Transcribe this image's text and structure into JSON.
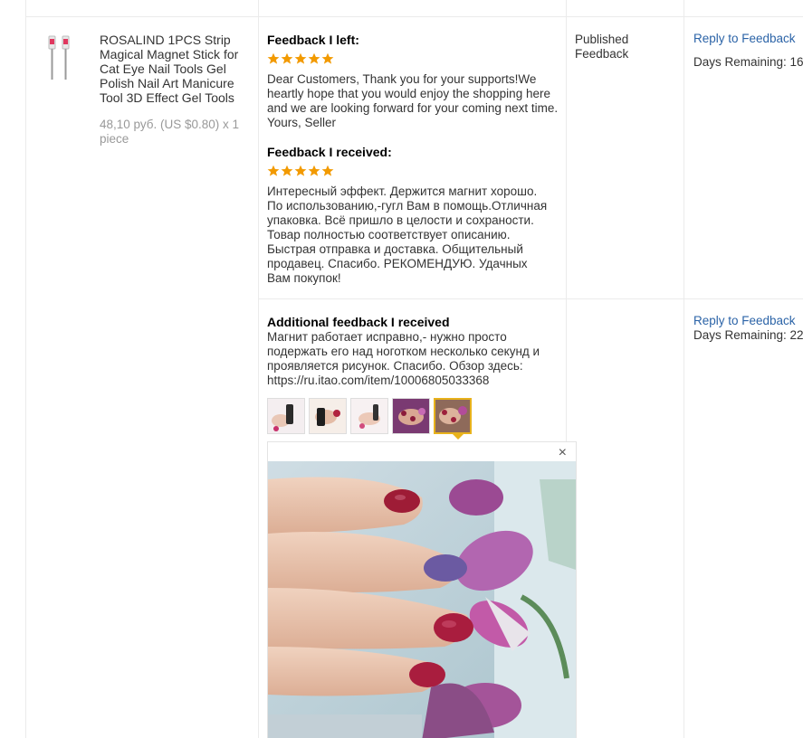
{
  "product": {
    "title": "ROSALIND 1PCS Strip Magical Magnet Stick for Cat Eye Nail Tools Gel Polish Nail Art Manicure Tool 3D Effect Gel Tools",
    "price": "48,10 руб. (US $0.80) x 1 piece"
  },
  "feedback_left": {
    "heading": "Feedback I left:",
    "rating": 5,
    "text": "Dear Customers, Thank you for your supports!We heartly hope that you would enjoy the shopping here and we are looking forward for your coming next time. Yours, Seller"
  },
  "feedback_received": {
    "heading": "Feedback I received:",
    "rating": 5,
    "text": "Интересный эффект. Держится магнит хорошо. По использованию,-гугл Вам в помощь.Отличная упаковка. Всё пришло в целости и сохраности. Товар полностью соответствует описанию. Быстрая отправка и доставка. Общительный продавец. Спасибо. РЕКОМЕНДУЮ. Удачных Вам покупок!"
  },
  "additional_feedback": {
    "heading": "Additional feedback I received",
    "text": "Магнит работает исправно,- нужно просто подержать его над ноготком несколько секунд и проявляется рисунок. Спасибо. Обзор здесь: https://ru.itao.com/item/10006805033368",
    "thumbnail_count": 5,
    "active_thumbnail": 5,
    "close_icon": "×"
  },
  "status": {
    "line1": "Published",
    "line2": "Feedback"
  },
  "actions": {
    "reply_1": "Reply to Feedback",
    "days_1": "Days Remaining: 16",
    "reply_2": "Reply to Feedback",
    "days_2": "Days Remaining: 22"
  },
  "colors": {
    "link": "#2b63a7",
    "star": "#f29a00",
    "active_border": "#e8b21c"
  }
}
